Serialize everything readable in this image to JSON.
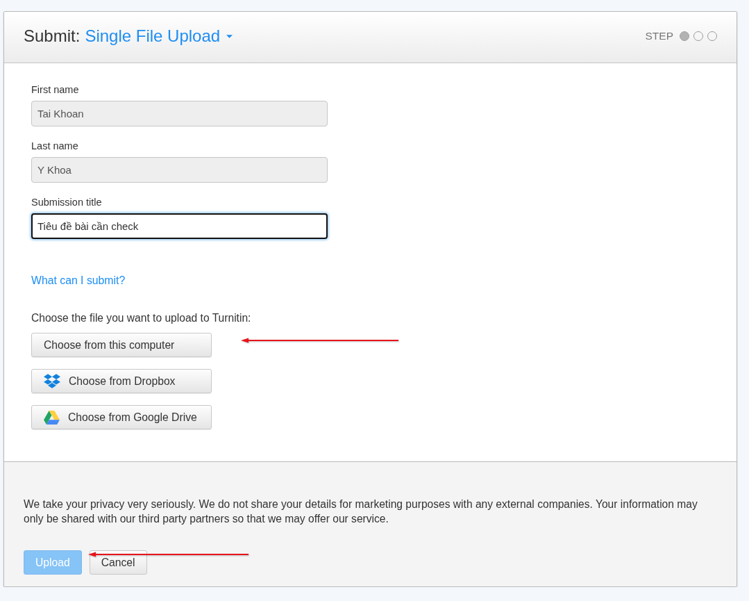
{
  "header": {
    "title": "Submit:",
    "mode_menu": {
      "label": "Single File Upload"
    },
    "step": {
      "label": "STEP",
      "dots": [
        {
          "selected": true
        },
        {
          "selected": false
        },
        {
          "selected": false
        }
      ]
    }
  },
  "form": {
    "fields": [
      {
        "label": "First name",
        "value": "Tai Khoan",
        "disabled": true,
        "focused": false
      },
      {
        "label": "Last name",
        "value": "Y Khoa",
        "disabled": true,
        "focused": false
      },
      {
        "label": "Submission title",
        "value": "Tiêu đề bài cần check",
        "disabled": false,
        "focused": true
      }
    ],
    "help_link": "What can I submit?",
    "file_prompt": "Choose the file you want to upload to Turnitin:",
    "file_buttons": [
      {
        "kind": "computer",
        "label": "Choose from this computer"
      },
      {
        "kind": "dropbox",
        "label": "Choose from Dropbox"
      },
      {
        "kind": "google_drive",
        "label": "Choose from Google Drive"
      }
    ]
  },
  "footer": {
    "privacy_note": "We take your privacy very seriously. We do not share your details for marketing purposes with any external companies. Your information may only be shared with our third party partners so that we may offer our service.",
    "buttons": [
      {
        "kind": "upload",
        "label": "Upload",
        "disabled": true
      },
      {
        "kind": "cancel",
        "label": "Cancel",
        "disabled": false
      }
    ]
  }
}
